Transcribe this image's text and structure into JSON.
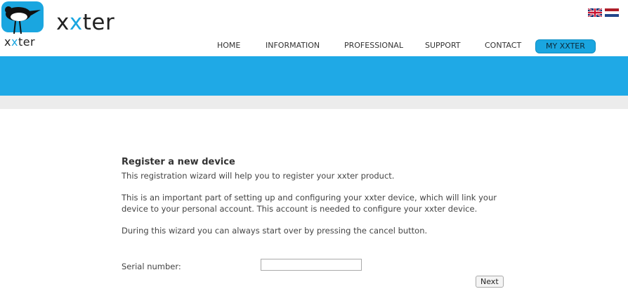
{
  "brand": {
    "logo_word_a": "x",
    "logo_word_b": "x",
    "logo_word_rest": "ter",
    "logo_small_a": "x",
    "logo_small_b": "x",
    "logo_small_rest": "ter",
    "accent_color": "#1aa6e0"
  },
  "flags": [
    {
      "name": "uk-flag-icon"
    },
    {
      "name": "netherlands-flag-icon"
    }
  ],
  "nav": {
    "items": [
      {
        "label": "HOME"
      },
      {
        "label": "INFORMATION"
      },
      {
        "label": "PROFESSIONAL"
      },
      {
        "label": "SUPPORT"
      },
      {
        "label": "CONTACT"
      },
      {
        "label": "MY XXTER"
      }
    ]
  },
  "main": {
    "title": "Register a new device",
    "intro": "This registration wizard will help you to register your xxter product.",
    "para2": "This is an important part of setting up and configuring your xxter device, which will link your device to your personal account. This account is needed to configure your xxter device.",
    "para3": "During this wizard you can always start over by pressing the cancel button.",
    "serial_label": "Serial number:",
    "serial_value": "",
    "next_label": "Next"
  },
  "colors": {
    "banner": "#1fa9e6",
    "graybar": "#ececec"
  }
}
